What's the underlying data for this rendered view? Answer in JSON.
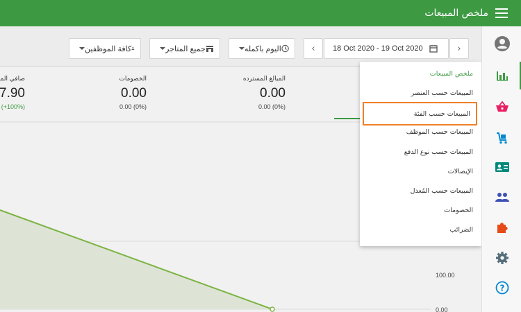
{
  "header": {
    "title": "ملخص المبيعات"
  },
  "toolbar": {
    "date_range": "18 Oct 2020 - 19 Oct 2020",
    "time_filter": "اليوم باكمله",
    "store_filter": "جميع المتاجر",
    "employee_filter": "كافة الموظفين"
  },
  "summary": {
    "net_sales": {
      "label": "صافي المبيعات",
      "value": "7.90",
      "change": "(+100%)"
    },
    "discounts": {
      "label": "الخصومات",
      "value": "0.00",
      "change": "0.00 (0%)"
    },
    "refunds": {
      "label": "المبالغ المسترده",
      "value": "0.00",
      "change": "0.00 (0%)"
    }
  },
  "chart_data": {
    "type": "area",
    "y_tick_labels": [
      "100.00",
      "0.00"
    ],
    "series": [
      {
        "values": [
          null,
          0.0
        ]
      }
    ]
  },
  "menu": {
    "items": [
      "ملخص المبيعات",
      "المبيعات حسب العنصر",
      "المبيعات حسب الفئة",
      "المبيعات حسب الموظف",
      "المبيعات حسب نوع الدفع",
      "الإيصالات",
      "المبيعات حسب المُعدل",
      "الخصومات",
      "الضرائب"
    ],
    "active_index": 0,
    "highlighted_index": 2
  },
  "colors": {
    "brand": "#3d9a43",
    "highlight": "#ef7f2a"
  }
}
